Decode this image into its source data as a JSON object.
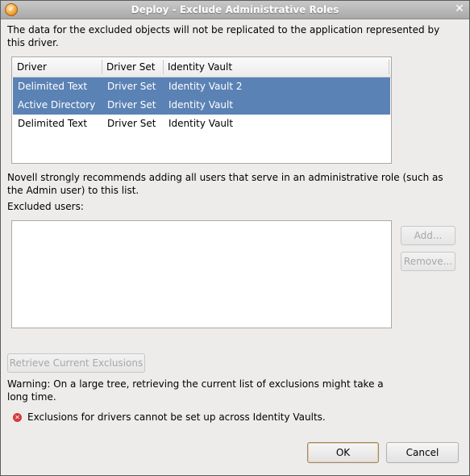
{
  "window": {
    "title": "Deploy - Exclude Administrative Roles",
    "close_glyph": "✕"
  },
  "intro_text": "The data for the excluded objects will not be replicated to the application represented by this driver.",
  "drivers_table": {
    "columns": [
      "Driver",
      "Driver Set",
      "Identity Vault"
    ],
    "rows": [
      {
        "driver": "Delimited Text",
        "driver_set": "Driver Set",
        "vault": "Identity Vault 2",
        "selected": true
      },
      {
        "driver": "Active Directory",
        "driver_set": "Driver Set",
        "vault": "Identity Vault",
        "selected": true
      },
      {
        "driver": "Delimited Text",
        "driver_set": "Driver Set",
        "vault": "Identity Vault",
        "selected": false
      }
    ]
  },
  "recommend_text": "Novell strongly recommends adding all users that serve in an administrative role (such as the Admin user) to this list.",
  "excluded_label": "Excluded users:",
  "buttons": {
    "add": "Add...",
    "remove": "Remove...",
    "retrieve": "Retrieve Current Exclusions",
    "ok": "OK",
    "cancel": "Cancel"
  },
  "warning_text": "Warning: On a large tree, retrieving the current list of exclusions might take a long time.",
  "error_text": "Exclusions for drivers cannot be set up across Identity Vaults.",
  "icons": {
    "app": "app-icon",
    "error": "error-icon",
    "close": "close-icon"
  },
  "colors": {
    "selection": "#5b82b4",
    "error": "#d33a3a"
  }
}
